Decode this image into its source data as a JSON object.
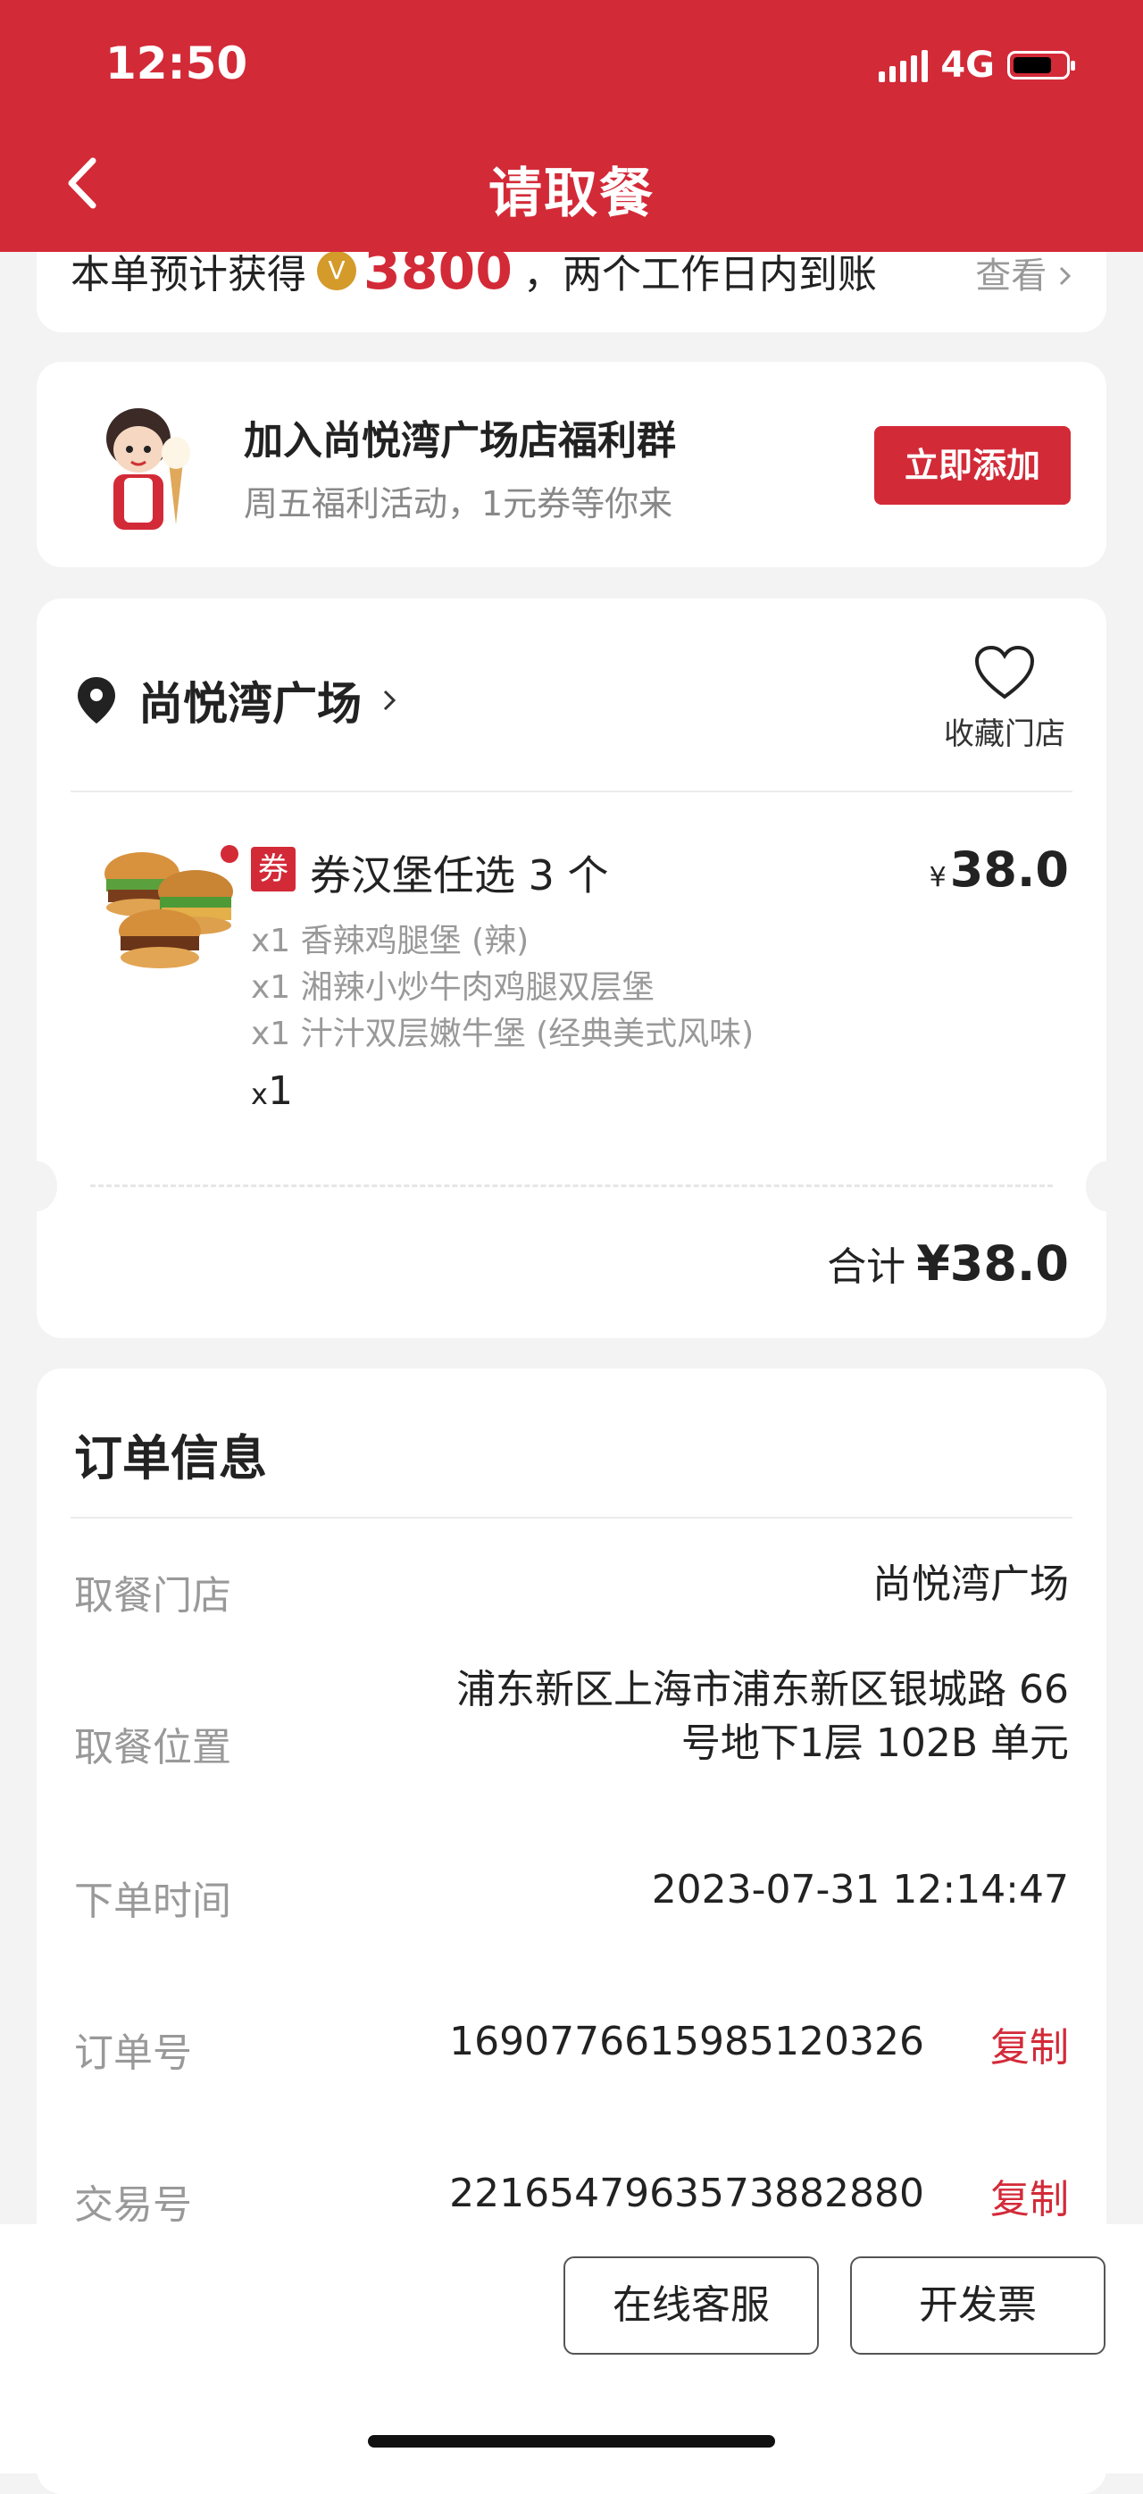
{
  "status_bar": {
    "time": "12:50",
    "network": "4G"
  },
  "header": {
    "title": "请取餐"
  },
  "reward": {
    "prefix": "本单预计获得",
    "coin_symbol": "V",
    "points": "3800",
    "suffix": "，两个工作日内到账",
    "view_label": "查看"
  },
  "group": {
    "title": "加入尚悦湾广场店福利群",
    "subtitle": "周五福利活动，1元券等你来",
    "add_label": "立即添加"
  },
  "order": {
    "store_name": "尚悦湾广场",
    "favorite_label": "收藏门店",
    "item": {
      "tag": "券",
      "name": "券汉堡任选 3 个",
      "currency": "¥",
      "price": "38.0",
      "sub_items": [
        "x1 香辣鸡腿堡 (辣)",
        "x1 湘辣小炒牛肉鸡腿双层堡",
        "x1 汁汁双层嫩牛堡 (经典美式风味)"
      ],
      "qty_prefix": "x",
      "qty": "1"
    },
    "total_label": "合计",
    "total_value": "¥38.0"
  },
  "info": {
    "title": "订单信息",
    "rows": [
      {
        "label": "取餐门店",
        "value": "尚悦湾广场"
      },
      {
        "label": "取餐位置",
        "value_line1": "浦东新区上海市浦东新区银城路 66",
        "value_line2": "号地下1层 102B 单元"
      },
      {
        "label": "下单时间",
        "value": "2023-07-31 12:14:47"
      },
      {
        "label": "订单号",
        "value": "1690776615985120326",
        "action": "复制"
      },
      {
        "label": "交易号",
        "value": "2216547963573882880",
        "action": "复制"
      }
    ]
  },
  "bottom": {
    "service_label": "在线客服",
    "invoice_label": "开发票"
  },
  "colors": {
    "brand_red": "#d32a38",
    "coin_gold": "#d49a2a"
  }
}
